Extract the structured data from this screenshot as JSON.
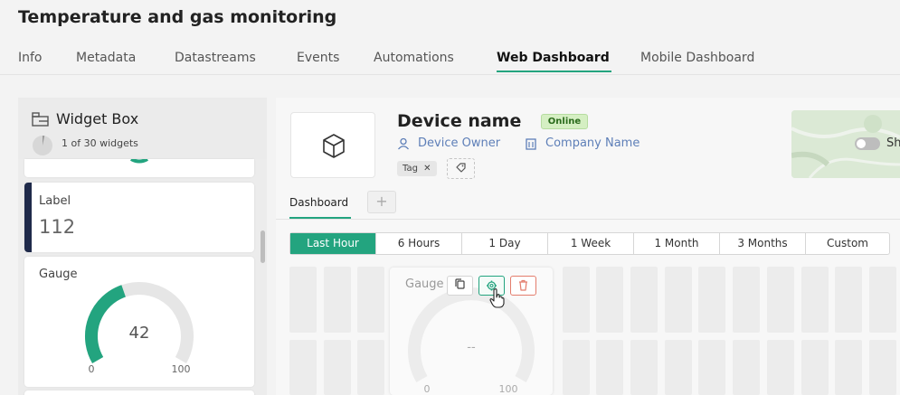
{
  "page": {
    "title": "Temperature and gas monitoring"
  },
  "tabs": [
    {
      "label": "Info",
      "active": false
    },
    {
      "label": "Metadata",
      "active": false
    },
    {
      "label": "Datastreams",
      "active": false
    },
    {
      "label": "Events",
      "active": false
    },
    {
      "label": "Automations",
      "active": false
    },
    {
      "label": "Web Dashboard",
      "active": true
    },
    {
      "label": "Mobile Dashboard",
      "active": false
    }
  ],
  "widget_box": {
    "title": "Widget Box",
    "count_text": "1 of 30 widgets",
    "widgets_used_fraction": 0.033,
    "label_widget": {
      "name": "Label",
      "value": "112"
    },
    "gauge_widget": {
      "name": "Gauge",
      "value": "42",
      "min": "0",
      "max": "100",
      "fill_fraction": 0.42
    }
  },
  "device": {
    "name": "Device name",
    "status": "Online",
    "owner": "Device Owner",
    "company": "Company Name",
    "tag": "Tag",
    "map_toggle_label": "Sh"
  },
  "dashboard": {
    "tab_label": "Dashboard",
    "add_tab_label": "+",
    "time_ranges": [
      {
        "label": "Last Hour",
        "active": true
      },
      {
        "label": "6 Hours",
        "active": false
      },
      {
        "label": "1 Day",
        "active": false
      },
      {
        "label": "1 Week",
        "active": false
      },
      {
        "label": "1 Month",
        "active": false
      },
      {
        "label": "3 Months",
        "active": false
      },
      {
        "label": "Custom",
        "active": false
      }
    ],
    "placed_gauge": {
      "name": "Gauge",
      "value": "--",
      "min": "0",
      "max": "100"
    }
  },
  "icons": {
    "widget_box": "widget-box-icon",
    "device": "cube-icon",
    "owner": "user-icon",
    "company": "building-icon",
    "tag_remove": "close-icon",
    "tag_add": "tag-icon",
    "copy": "copy-icon",
    "settings": "gear-icon",
    "delete": "trash-icon",
    "cursor": "hand-pointer-icon"
  },
  "colors": {
    "accent": "#23a47f",
    "label_bar": "#1f2a4a",
    "link": "#5e7fb8",
    "delete": "#e37d6d"
  }
}
